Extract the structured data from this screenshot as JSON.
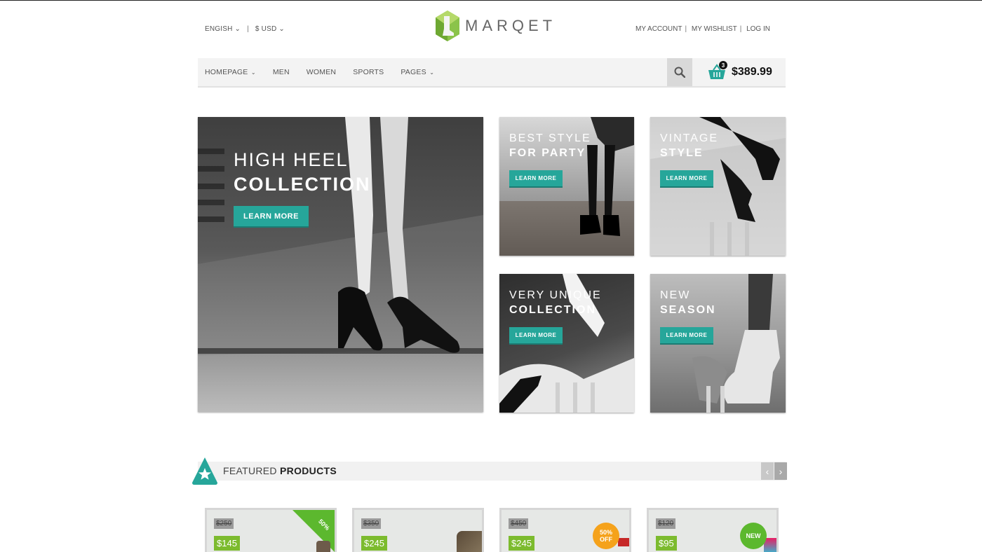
{
  "header": {
    "language": "ENGISH",
    "currency": "$ USD",
    "brand": "MARQET",
    "account_links": [
      "MY ACCOUNT",
      "MY WISHLIST",
      "LOG IN"
    ]
  },
  "nav": {
    "items": [
      {
        "label": "HOMEPAGE",
        "dropdown": true
      },
      {
        "label": "MEN",
        "dropdown": false
      },
      {
        "label": "WOMEN",
        "dropdown": false
      },
      {
        "label": "SPORTS",
        "dropdown": false
      },
      {
        "label": "PAGES",
        "dropdown": true
      }
    ],
    "cart_count": "3",
    "cart_total": "$389.99"
  },
  "banners": {
    "main": {
      "line1": "HIGH HEEL",
      "line2": "COLLECTION",
      "button": "LEARN MORE"
    },
    "party": {
      "line1": "BEST STYLE",
      "line2": "FOR PARTY",
      "button": "LEARN MORE"
    },
    "vintage": {
      "line1": "VINTAGE",
      "line2": "STYLE",
      "button": "LEARN MORE"
    },
    "unique": {
      "line1": "VERY UNIQUE",
      "line2": "COLLECTION",
      "button": "LEARN MORE"
    },
    "season": {
      "line1": "NEW",
      "line2": "SEASON",
      "button": "LEARN MORE"
    }
  },
  "featured": {
    "title_light": "FEATURED",
    "title_bold": "PRODUCTS",
    "products": [
      {
        "old_price": "$250",
        "price": "$145",
        "badge": "50%"
      },
      {
        "old_price": "$350",
        "price": "$245",
        "badge": ""
      },
      {
        "old_price": "$450",
        "price": "$245",
        "badge": "50% OFF"
      },
      {
        "old_price": "$120",
        "price": "$95",
        "badge": "NEW"
      }
    ]
  },
  "colors": {
    "accent": "#26a69a",
    "price_green": "#7cbb2e",
    "sale_orange": "#f5a21b",
    "new_green": "#5cb82e"
  }
}
